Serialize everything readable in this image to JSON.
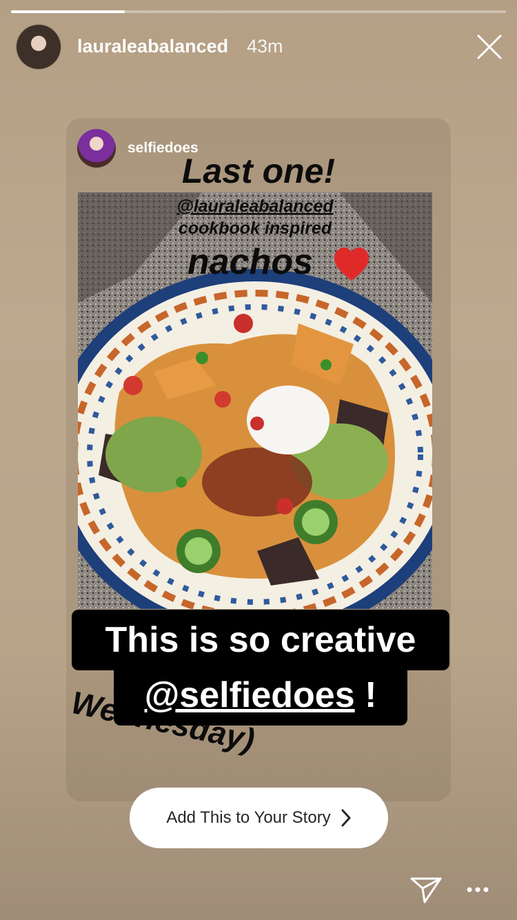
{
  "story": {
    "progress": 0.23
  },
  "header": {
    "username": "lauraleabalanced",
    "time": "43m",
    "close_icon": "close-icon"
  },
  "shared_post": {
    "username": "selfiedoes",
    "caption_line1": "Last one!",
    "caption_mention": "@lauraleabalanced",
    "caption_line2": "cookbook inspired",
    "caption_line3": "nachos",
    "caption_emoji": "❤️",
    "caption_partial": "Wednesday)"
  },
  "sticker": {
    "line1": "This is so creative",
    "mention": "@selfiedoes",
    "punct": "!"
  },
  "cta": {
    "label": "Add This to Your Story",
    "icon": "chevron-right-icon"
  },
  "footer": {
    "send_icon": "send-icon",
    "more_icon": "more-icon"
  }
}
